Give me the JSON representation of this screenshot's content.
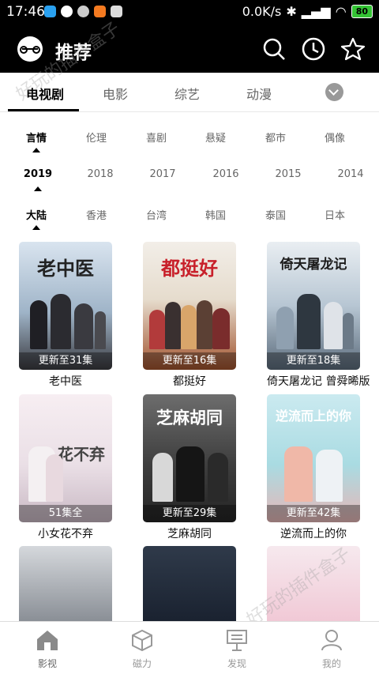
{
  "status_bar": {
    "time": "17:46",
    "net_speed": "0.0K/s",
    "battery": "80"
  },
  "header": {
    "title": "推荐"
  },
  "tabs": [
    {
      "label": "电视剧",
      "active": true
    },
    {
      "label": "电影"
    },
    {
      "label": "综艺"
    },
    {
      "label": "动漫"
    }
  ],
  "filters": {
    "genre": [
      "言情",
      "伦理",
      "喜剧",
      "悬疑",
      "都市",
      "偶像"
    ],
    "year": [
      "2019",
      "2018",
      "2017",
      "2016",
      "2015",
      "2014"
    ],
    "region": [
      "大陆",
      "香港",
      "台湾",
      "韩国",
      "泰国",
      "日本"
    ]
  },
  "shows": [
    {
      "name": "老中医",
      "badge": "更新至31集",
      "art": "老中医"
    },
    {
      "name": "都挺好",
      "badge": "更新至16集",
      "art": "都挺好"
    },
    {
      "name": "倚天屠龙记 曾舜晞版",
      "badge": "更新至18集",
      "art": "倚天屠龙记"
    },
    {
      "name": "小女花不弃",
      "badge": "51集全",
      "art": "花不弃"
    },
    {
      "name": "芝麻胡同",
      "badge": "更新至29集",
      "art": "芝麻胡同"
    },
    {
      "name": "逆流而上的你",
      "badge": "更新至42集",
      "art": "逆流而上的你"
    }
  ],
  "bottom_nav": [
    {
      "label": "影视",
      "icon": "home-icon"
    },
    {
      "label": "磁力",
      "icon": "cube-icon"
    },
    {
      "label": "发现",
      "icon": "board-icon"
    },
    {
      "label": "我的",
      "icon": "user-icon"
    }
  ],
  "watermark": "好玩的插件盒子",
  "colors": {
    "bar_bg": "#000000",
    "active_text": "#000000",
    "inactive_text": "#666666",
    "nav_inactive": "#999999",
    "battery": "#35c435"
  }
}
